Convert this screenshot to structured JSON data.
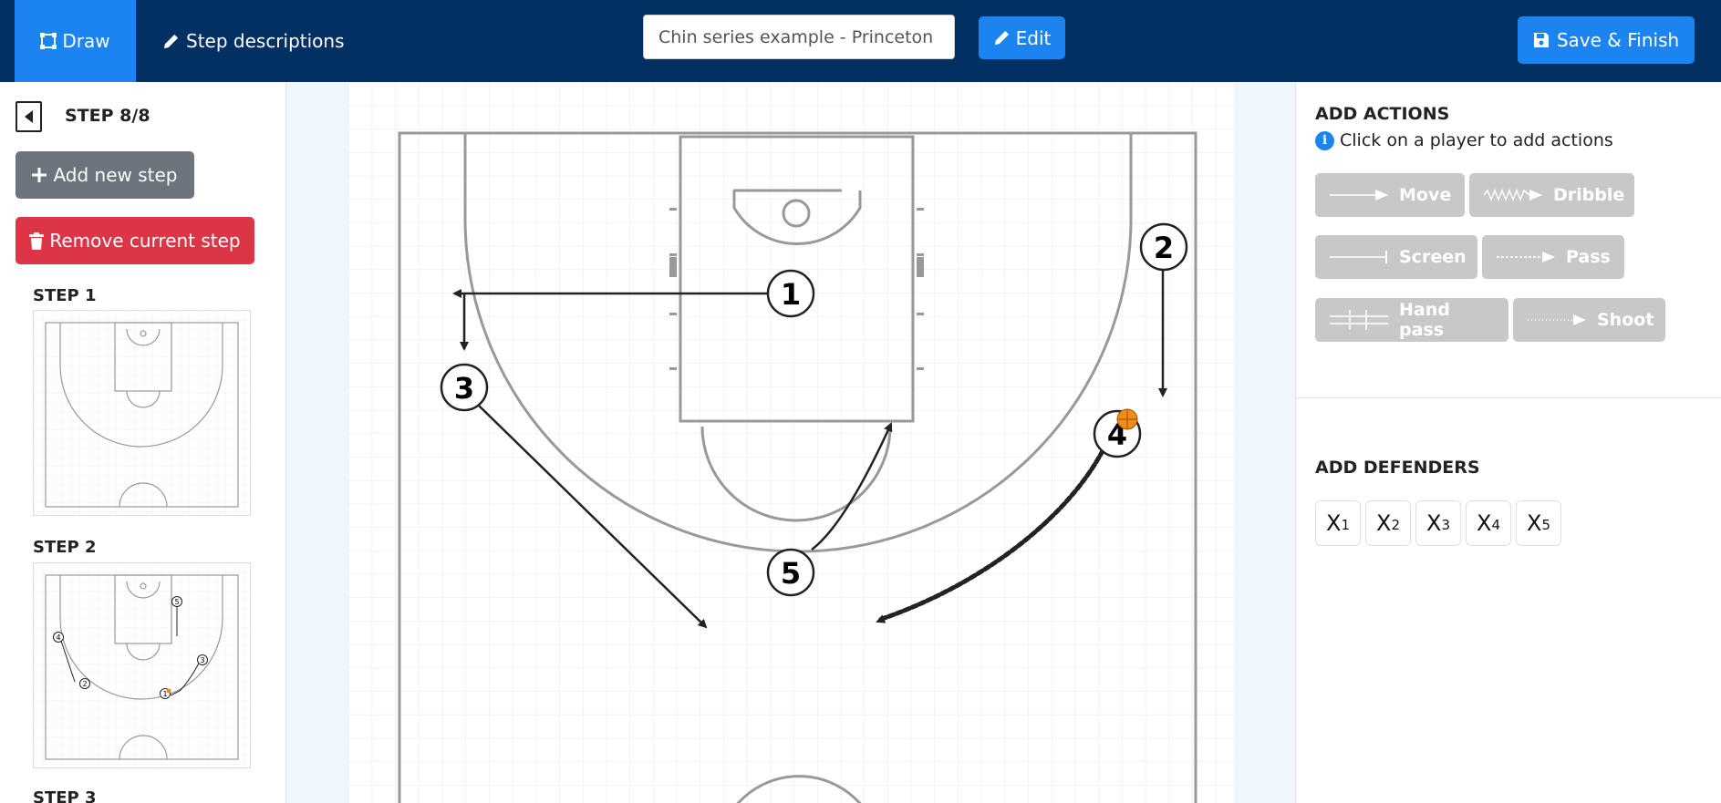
{
  "topbar": {
    "draw_tab": "Draw",
    "steps_tab": "Step descriptions",
    "title_value": "Chin series example - Princeton",
    "edit_label": "Edit",
    "save_label": "Save & Finish"
  },
  "sidebar": {
    "step_indicator": "STEP 8/8",
    "add_step_label": "Add new step",
    "remove_step_label": "Remove current step",
    "steps": [
      "STEP 1",
      "STEP 2",
      "STEP 3"
    ]
  },
  "court": {
    "players": [
      "1",
      "2",
      "3",
      "4",
      "5"
    ],
    "ball_holder": "4"
  },
  "actions": {
    "title": "ADD ACTIONS",
    "hint": "Click on a player to add actions",
    "buttons": [
      "Move",
      "Dribble",
      "Screen",
      "Pass",
      "Hand pass",
      "Shoot"
    ]
  },
  "defenders": {
    "title": "ADD DEFENDERS",
    "items": [
      {
        "letter": "X",
        "num": "1"
      },
      {
        "letter": "X",
        "num": "2"
      },
      {
        "letter": "X",
        "num": "3"
      },
      {
        "letter": "X",
        "num": "4"
      },
      {
        "letter": "X",
        "num": "5"
      }
    ]
  },
  "colors": {
    "topbar": "#033062",
    "primary": "#1c84f0",
    "secondary": "#6c757d",
    "danger": "#dc3545",
    "action_disabled": "#c8c8c8",
    "ball": "#f08c1c"
  }
}
